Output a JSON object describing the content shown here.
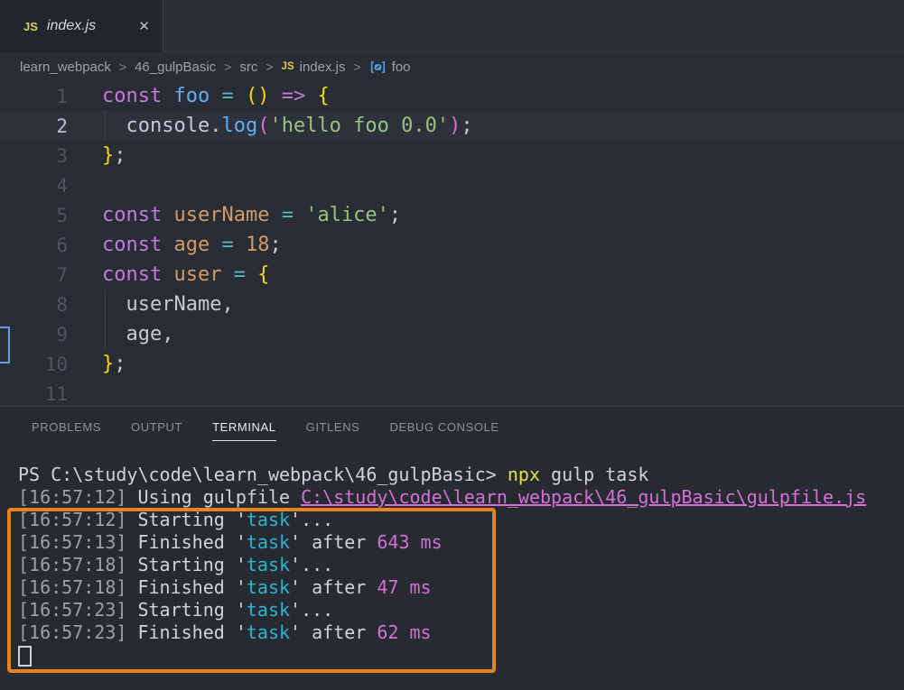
{
  "colors": {
    "editor_bg": "#282c34",
    "tab_bg": "#21252c",
    "panel_bg": "#262a31",
    "highlight_box": "#e8831d",
    "kw": "#c678dd",
    "fn": "#61afef",
    "op": "#56b6c2",
    "gold": "#ffd700",
    "orchid": "#da70d6",
    "str": "#98c379",
    "var": "#d19a66",
    "num": "#d19a66",
    "fg": "#c3cad6",
    "tfg": "#ced4dd",
    "dim": "#9aa1ad",
    "cyan": "#2fb3d3",
    "mag": "#d670d6",
    "magu": "#d670d6",
    "yellow": "#e3e052",
    "icon_js": "#e2cb4c",
    "icon_symbol": "#4fa3e0"
  },
  "tab": {
    "icon_text": "JS",
    "title": "index.js",
    "close_glyph": "✕"
  },
  "breadcrumbs": {
    "separator": ">",
    "items": [
      {
        "label": "learn_webpack"
      },
      {
        "label": "46_gulpBasic"
      },
      {
        "label": "src"
      },
      {
        "label": "index.js",
        "icon": "js"
      },
      {
        "label": "foo",
        "icon": "symbol"
      }
    ]
  },
  "editor": {
    "lines": [
      {
        "n": "1",
        "tokens": [
          [
            "kw",
            "const"
          ],
          [
            "fg",
            " "
          ],
          [
            "fn",
            "foo"
          ],
          [
            "fg",
            " "
          ],
          [
            "op",
            "="
          ],
          [
            "fg",
            " "
          ],
          [
            "gold",
            "()"
          ],
          [
            "fg",
            " "
          ],
          [
            "kw",
            "=>"
          ],
          [
            "fg",
            " "
          ],
          [
            "gold",
            "{"
          ]
        ]
      },
      {
        "n": "2",
        "current": true,
        "guide": true,
        "tokens": [
          [
            "fg",
            "  console."
          ],
          [
            "fn",
            "log"
          ],
          [
            "orchid",
            "("
          ],
          [
            "str",
            "'hello foo 0.0'"
          ],
          [
            "orchid",
            ")"
          ],
          [
            "fg",
            ";"
          ]
        ]
      },
      {
        "n": "3",
        "tokens": [
          [
            "gold",
            "}"
          ],
          [
            "fg",
            ";"
          ]
        ]
      },
      {
        "n": "4",
        "tokens": []
      },
      {
        "n": "5",
        "tokens": [
          [
            "kw",
            "const"
          ],
          [
            "fg",
            " "
          ],
          [
            "var",
            "userName"
          ],
          [
            "fg",
            " "
          ],
          [
            "op",
            "="
          ],
          [
            "fg",
            " "
          ],
          [
            "str",
            "'alice'"
          ],
          [
            "fg",
            ";"
          ]
        ]
      },
      {
        "n": "6",
        "tokens": [
          [
            "kw",
            "const"
          ],
          [
            "fg",
            " "
          ],
          [
            "var",
            "age"
          ],
          [
            "fg",
            " "
          ],
          [
            "op",
            "="
          ],
          [
            "fg",
            " "
          ],
          [
            "num",
            "18"
          ],
          [
            "fg",
            ";"
          ]
        ]
      },
      {
        "n": "7",
        "tokens": [
          [
            "kw",
            "const"
          ],
          [
            "fg",
            " "
          ],
          [
            "var",
            "user"
          ],
          [
            "fg",
            " "
          ],
          [
            "op",
            "="
          ],
          [
            "fg",
            " "
          ],
          [
            "gold",
            "{"
          ]
        ]
      },
      {
        "n": "8",
        "guide": true,
        "tokens": [
          [
            "fg",
            "  userName,"
          ]
        ]
      },
      {
        "n": "9",
        "guide": true,
        "tokens": [
          [
            "fg",
            "  age,"
          ]
        ]
      },
      {
        "n": "10",
        "tokens": [
          [
            "gold",
            "}"
          ],
          [
            "fg",
            ";"
          ]
        ]
      },
      {
        "n": "11",
        "tokens": []
      }
    ]
  },
  "panel": {
    "tabs": [
      {
        "label": "PROBLEMS",
        "active": false
      },
      {
        "label": "OUTPUT",
        "active": false
      },
      {
        "label": "TERMINAL",
        "active": true
      },
      {
        "label": "GITLENS",
        "active": false
      },
      {
        "label": "DEBUG CONSOLE",
        "active": false
      }
    ]
  },
  "terminal": {
    "lines": [
      [
        [
          "tfg",
          "PS C:\\study\\code\\learn_webpack\\46_gulpBasic> "
        ],
        [
          "yellow",
          "npx"
        ],
        [
          "tfg",
          " gulp task"
        ]
      ],
      [
        [
          "dim",
          "[16:57:12] "
        ],
        [
          "tfg",
          "Using gulpfile "
        ],
        [
          "magu",
          "C:\\study\\code\\learn_webpack\\46_gulpBasic\\gulpfile.js"
        ]
      ],
      [
        [
          "dim",
          "[16:57:12] "
        ],
        [
          "tfg",
          "Starting '"
        ],
        [
          "cyan",
          "task"
        ],
        [
          "tfg",
          "'..."
        ]
      ],
      [
        [
          "dim",
          "[16:57:13] "
        ],
        [
          "tfg",
          "Finished '"
        ],
        [
          "cyan",
          "task"
        ],
        [
          "tfg",
          "' after "
        ],
        [
          "mag",
          "643 ms"
        ]
      ],
      [
        [
          "dim",
          "[16:57:18] "
        ],
        [
          "tfg",
          "Starting '"
        ],
        [
          "cyan",
          "task"
        ],
        [
          "tfg",
          "'..."
        ]
      ],
      [
        [
          "dim",
          "[16:57:18] "
        ],
        [
          "tfg",
          "Finished '"
        ],
        [
          "cyan",
          "task"
        ],
        [
          "tfg",
          "' after "
        ],
        [
          "mag",
          "47 ms"
        ]
      ],
      [
        [
          "dim",
          "[16:57:23] "
        ],
        [
          "tfg",
          "Starting '"
        ],
        [
          "cyan",
          "task"
        ],
        [
          "tfg",
          "'..."
        ]
      ],
      [
        [
          "dim",
          "[16:57:23] "
        ],
        [
          "tfg",
          "Finished '"
        ],
        [
          "cyan",
          "task"
        ],
        [
          "tfg",
          "' after "
        ],
        [
          "mag",
          "62 ms"
        ]
      ]
    ]
  }
}
